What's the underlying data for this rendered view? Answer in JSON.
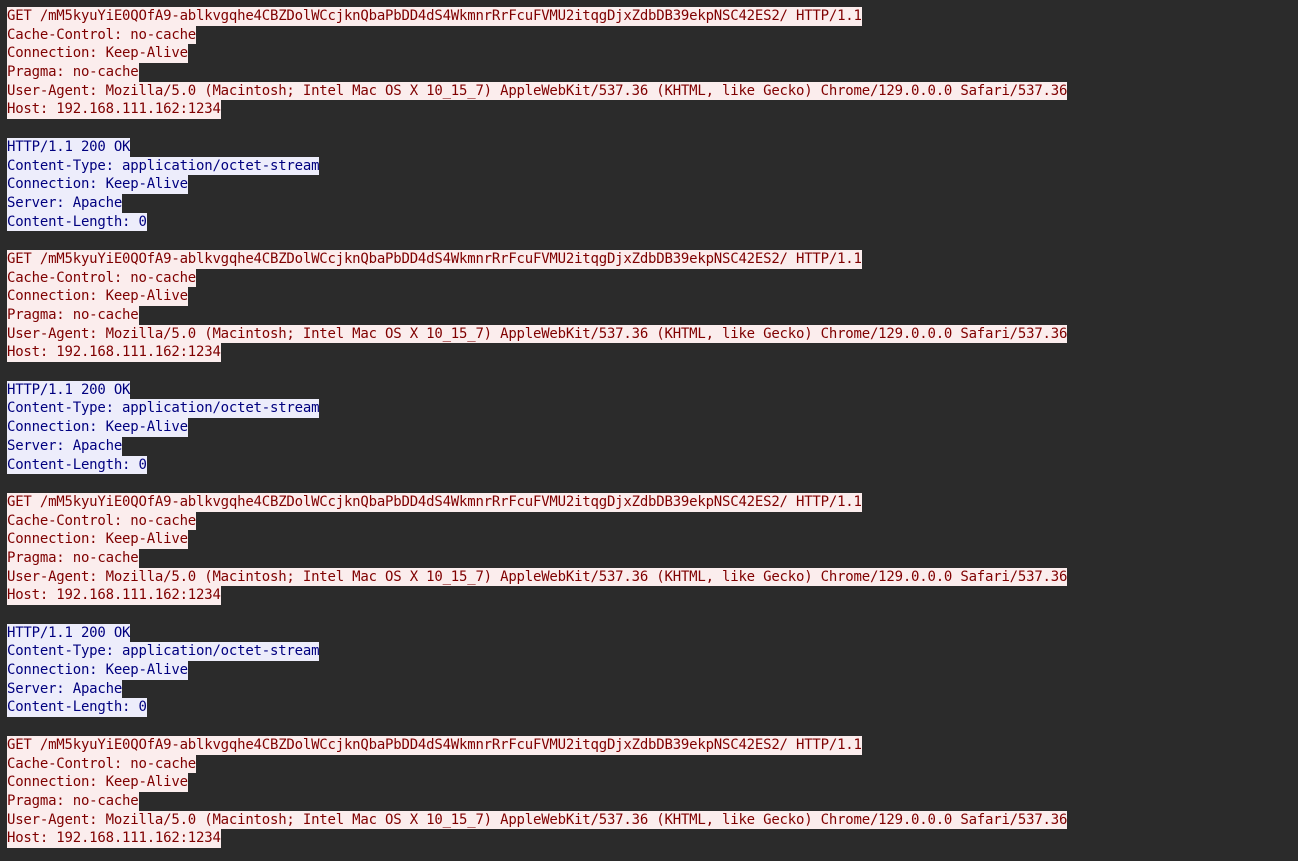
{
  "stream": {
    "blocks": [
      {
        "role": "client",
        "lines": [
          "GET /mM5kyuYiE0QOfA9-ablkvgqhe4CBZDolWCcjknQbaPbDD4dS4WkmnrRrFcuFVMU2itqgDjxZdbDB39ekpNSC42ES2/ HTTP/1.1",
          "Cache-Control: no-cache",
          "Connection: Keep-Alive",
          "Pragma: no-cache",
          "User-Agent: Mozilla/5.0 (Macintosh; Intel Mac OS X 10_15_7) AppleWebKit/537.36 (KHTML, like Gecko) Chrome/129.0.0.0 Safari/537.36",
          "Host: 192.168.111.162:1234"
        ]
      },
      {
        "role": "server",
        "lines": [
          "HTTP/1.1 200 OK",
          "Content-Type: application/octet-stream",
          "Connection: Keep-Alive",
          "Server: Apache",
          "Content-Length: 0"
        ]
      },
      {
        "role": "client",
        "lines": [
          "GET /mM5kyuYiE0QOfA9-ablkvgqhe4CBZDolWCcjknQbaPbDD4dS4WkmnrRrFcuFVMU2itqgDjxZdbDB39ekpNSC42ES2/ HTTP/1.1",
          "Cache-Control: no-cache",
          "Connection: Keep-Alive",
          "Pragma: no-cache",
          "User-Agent: Mozilla/5.0 (Macintosh; Intel Mac OS X 10_15_7) AppleWebKit/537.36 (KHTML, like Gecko) Chrome/129.0.0.0 Safari/537.36",
          "Host: 192.168.111.162:1234"
        ]
      },
      {
        "role": "server",
        "lines": [
          "HTTP/1.1 200 OK",
          "Content-Type: application/octet-stream",
          "Connection: Keep-Alive",
          "Server: Apache",
          "Content-Length: 0"
        ]
      },
      {
        "role": "client",
        "lines": [
          "GET /mM5kyuYiE0QOfA9-ablkvgqhe4CBZDolWCcjknQbaPbDD4dS4WkmnrRrFcuFVMU2itqgDjxZdbDB39ekpNSC42ES2/ HTTP/1.1",
          "Cache-Control: no-cache",
          "Connection: Keep-Alive",
          "Pragma: no-cache",
          "User-Agent: Mozilla/5.0 (Macintosh; Intel Mac OS X 10_15_7) AppleWebKit/537.36 (KHTML, like Gecko) Chrome/129.0.0.0 Safari/537.36",
          "Host: 192.168.111.162:1234"
        ]
      },
      {
        "role": "server",
        "lines": [
          "HTTP/1.1 200 OK",
          "Content-Type: application/octet-stream",
          "Connection: Keep-Alive",
          "Server: Apache",
          "Content-Length: 0"
        ]
      },
      {
        "role": "client",
        "lines": [
          "GET /mM5kyuYiE0QOfA9-ablkvgqhe4CBZDolWCcjknQbaPbDD4dS4WkmnrRrFcuFVMU2itqgDjxZdbDB39ekpNSC42ES2/ HTTP/1.1",
          "Cache-Control: no-cache",
          "Connection: Keep-Alive",
          "Pragma: no-cache",
          "User-Agent: Mozilla/5.0 (Macintosh; Intel Mac OS X 10_15_7) AppleWebKit/537.36 (KHTML, like Gecko) Chrome/129.0.0.0 Safari/537.36",
          "Host: 192.168.111.162:1234"
        ]
      }
    ]
  },
  "colors": {
    "background": "#2b2b2b",
    "client_text": "#7f0000",
    "client_highlight": "#fbeded",
    "server_text": "#00007f",
    "server_highlight": "#ededfb"
  }
}
